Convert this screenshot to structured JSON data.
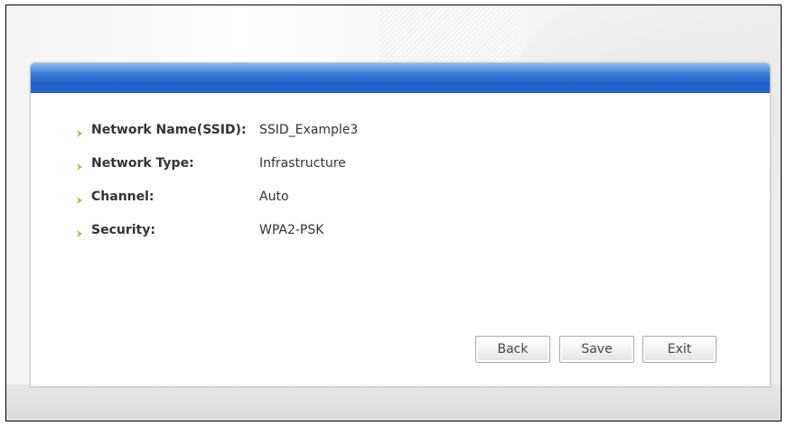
{
  "summary": {
    "rows": [
      {
        "label": "Network Name(SSID):",
        "value": "SSID_Example3"
      },
      {
        "label": "Network Type:",
        "value": "Infrastructure"
      },
      {
        "label": "Channel:",
        "value": "Auto"
      },
      {
        "label": "Security:",
        "value": "WPA2-PSK"
      }
    ]
  },
  "buttons": {
    "back": "Back",
    "save": "Save",
    "exit": "Exit"
  },
  "colors": {
    "header_blue": "#2a69d2",
    "bullet_green": "#8dc63f"
  },
  "icons": {
    "bullet": "green-arrow-bullet-icon"
  }
}
